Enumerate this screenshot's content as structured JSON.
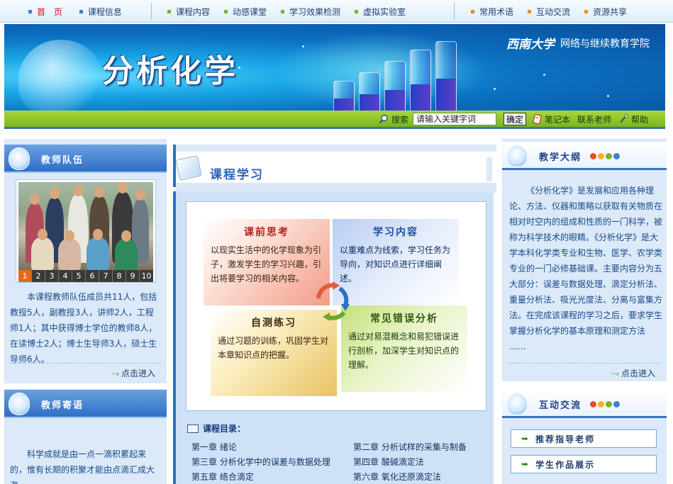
{
  "nav": {
    "group1": [
      {
        "label": "首 页"
      },
      {
        "label": "课程信息"
      }
    ],
    "group2": [
      {
        "label": "课程内容"
      },
      {
        "label": "动感课堂"
      },
      {
        "label": "学习效果检测"
      },
      {
        "label": "虚拟实验室"
      }
    ],
    "group3": [
      {
        "label": "常用术语"
      },
      {
        "label": "互动交流"
      },
      {
        "label": "资源共享"
      }
    ]
  },
  "banner": {
    "title": "分析化学",
    "university": "西南大学",
    "college": "网络与继续教育学院"
  },
  "search": {
    "label": "搜索",
    "placeholder": "请输入关键字词",
    "button": "确定",
    "notebook": "笔记本",
    "contact": "联系老师",
    "help": "帮助"
  },
  "left": {
    "team": {
      "title": "教师队伍",
      "pages": [
        "1",
        "2",
        "3",
        "4",
        "5",
        "6",
        "7",
        "8",
        "9",
        "10"
      ],
      "active_page": "1",
      "text": "本课程教师队伍成员共11人，包括教授5人，副教授3人，讲师2人，工程师1人；其中获得博士学位的教师8人，在读博士2人；博士生导师3人，硕士生导师6人。",
      "more": "点击进入"
    },
    "message": {
      "title": "教师寄语",
      "text": "科学成就是由一点一滴积累起来的，惟有长期的积聚才能由点滴汇成大海。"
    }
  },
  "center": {
    "title": "课程学习",
    "tiles": {
      "pre": {
        "title": "课前思考",
        "text": "以现实生活中的化学现象为引子，激发学生的学习兴趣，引出将要学习的相关内容。"
      },
      "content": {
        "title": "学习内容",
        "text": "以重难点为线索，学习任务为导向，对知识点进行详细阐述。"
      },
      "self": {
        "title": "自测练习",
        "text": "通过习题的训练，巩固学生对本章知识点的把握。"
      },
      "errors": {
        "title": "常见错误分析",
        "text": "通过对易混概念和易犯错误进行剖析，加深学生对知识点的理解。"
      }
    },
    "catalog_title": "课程目录：",
    "chapters": [
      "第一章  绪论",
      "第二章  分析试样的采集与制备",
      "第三章  分析化学中的误差与数据处理",
      "第四章  酸碱滴定法",
      "第五章  络合滴定",
      "第六章  氧化还原滴定法"
    ]
  },
  "right": {
    "outline": {
      "title": "教学大纲",
      "text": "《分析化学》是发展和应用各种理论、方法、仪器和策略以获取有关物质在相对时空内的组成和性质的一门科学，被称为科学技术的眼睛。《分析化学》是大学本科化学类专业和生物、医学、农学类专业的一门必修基础课。主要内容分为五大部分：误差与数据处理、滴定分析法、重量分析法、吸光光度法、分离与富集方法。在完成该课程的学习之后，要求学生掌握分析化学的基本原理和测定方法 ……",
      "more": "点击进入"
    },
    "interact": {
      "title": "互动交流",
      "buttons": [
        "推荐指导老师",
        "学生作品展示"
      ]
    }
  },
  "colors": {
    "nav_bullet_blue": "#3d7fd0",
    "nav_bullet_green": "#7ab42a",
    "nav_bullet_orange": "#f28b1c",
    "home_red": "#d0161b",
    "search_bar_green": "#8cc32a",
    "panel_blue": "#2f6fc6",
    "dots": [
      "#e84a2a",
      "#f2b21c",
      "#7ab42a",
      "#3d7fd0"
    ]
  }
}
